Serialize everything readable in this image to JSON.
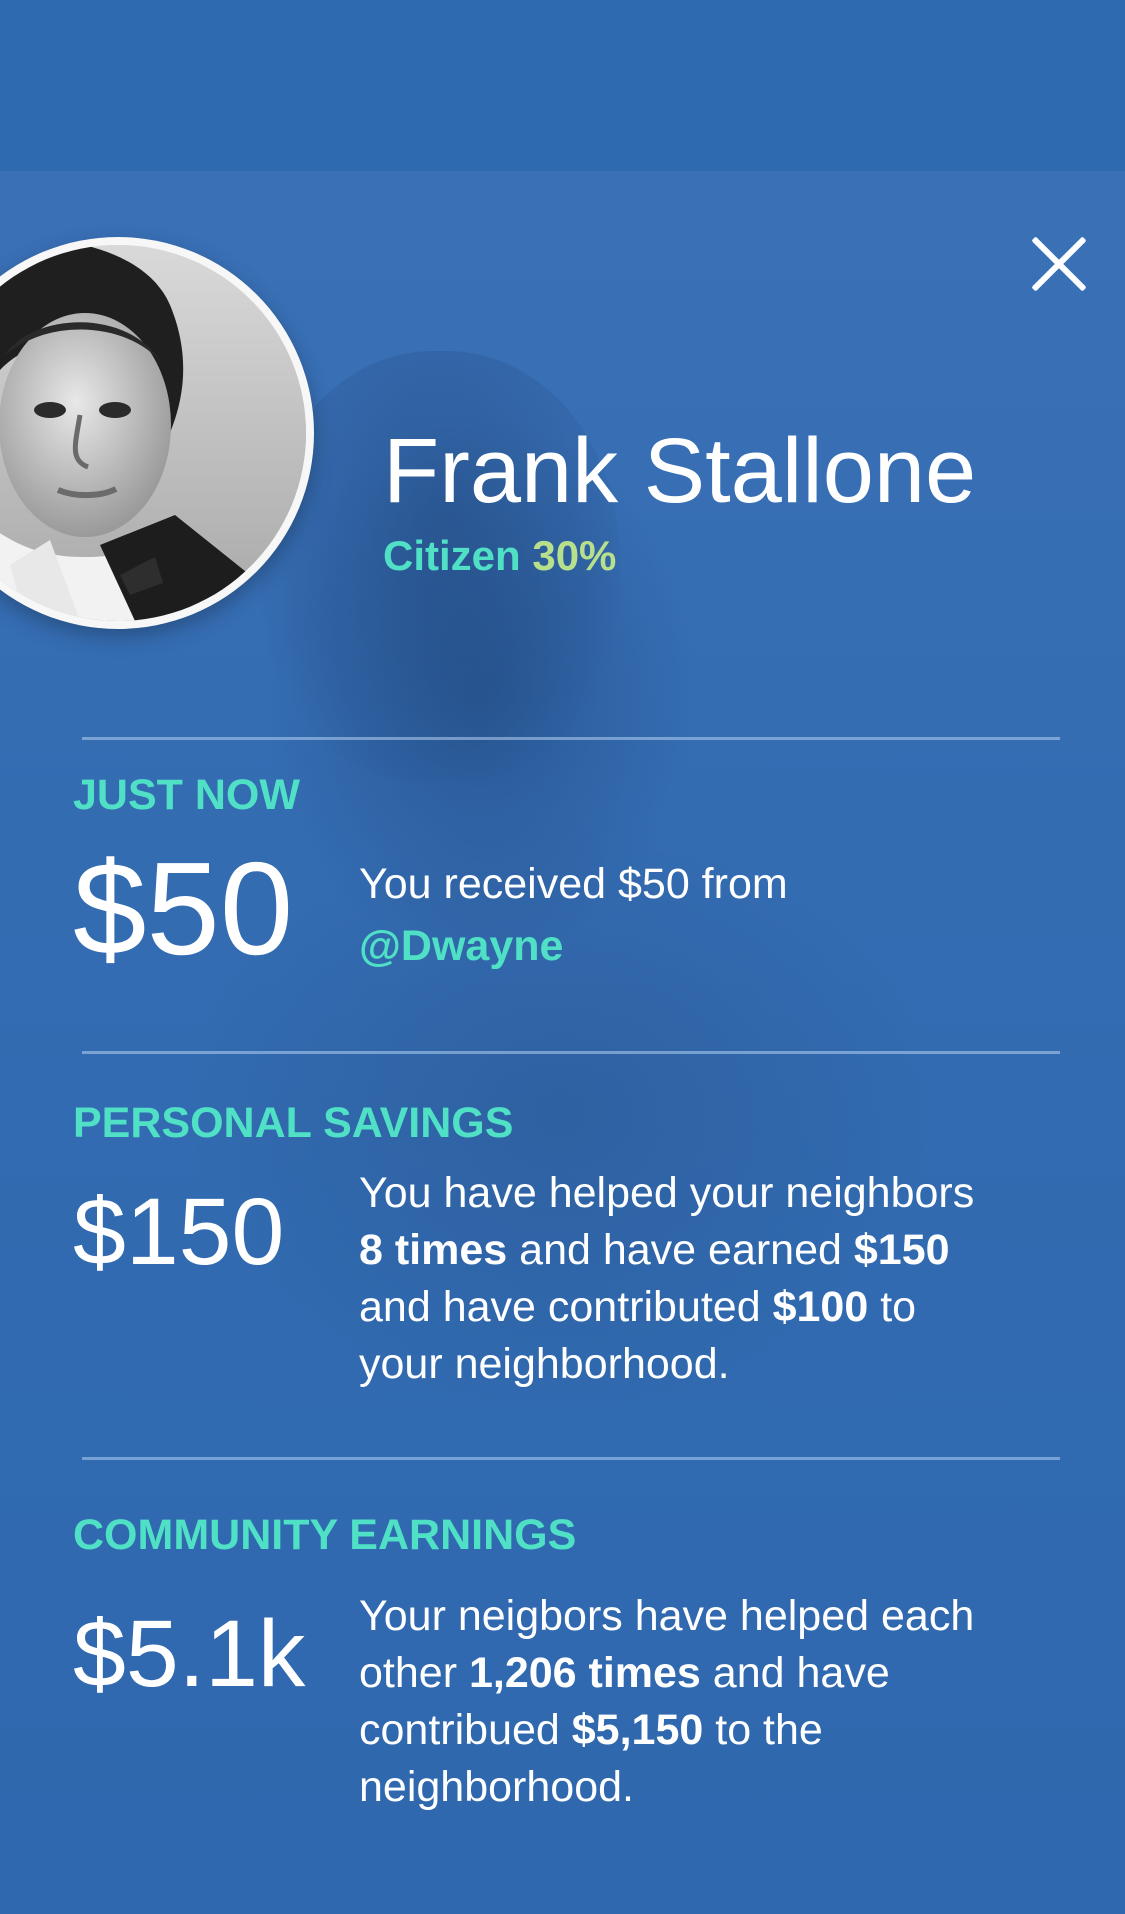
{
  "colors": {
    "background": "#2f6bb1",
    "top_bar": "#2e6ab0",
    "accent_teal": "#4fe0c6",
    "accent_lime": "#b7e08c",
    "text_white": "#ffffff",
    "divider": "#9fc0e6"
  },
  "header": {
    "close_icon": "close-icon"
  },
  "profile": {
    "name": "Frank Stallone",
    "status_label": "Citizen",
    "status_percent": "30%"
  },
  "sections": {
    "just_now": {
      "title": "JUST NOW",
      "amount": "$50",
      "text_prefix": "You received $50 from",
      "handle": "@Dwayne"
    },
    "personal_savings": {
      "title": "PERSONAL SAVINGS",
      "amount": "$150",
      "line1": "You have helped your neighbors",
      "times": "8 times",
      "earned_mid": " and have earned ",
      "earned_amount": "$150",
      "contributed_prefix": "and have contributed ",
      "contributed_amount": "$100",
      "contributed_suffix": " to",
      "line4": "your neighborhood."
    },
    "community_earnings": {
      "title": "COMMUNITY EARNINGS",
      "amount": "$5.1k",
      "line1": "Your neigbors have helped each",
      "other_prefix": "other ",
      "times": "1,206 times",
      "other_suffix": " and have",
      "contributed_prefix": "contribued ",
      "contributed_amount": "$5,150",
      "contributed_suffix": " to the",
      "line4": "neighborhood."
    }
  }
}
